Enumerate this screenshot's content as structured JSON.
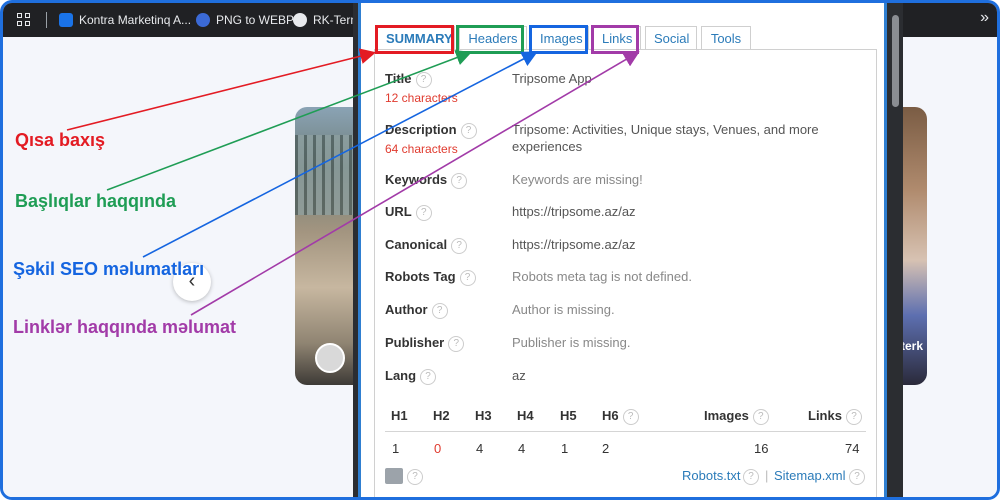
{
  "bookmarks": [
    {
      "label": "Kontra Marketinq A...",
      "color": "#1a73e8"
    },
    {
      "label": "PNG to WEBP",
      "color": "#3b6ad6"
    },
    {
      "label": "RK-Termi",
      "color": "#5f6368"
    }
  ],
  "bookmarks_more": "»",
  "background": {
    "right_card_text": "terk",
    "chevron": "‹"
  },
  "tabs": [
    "SUMMARY",
    "Headers",
    "Images",
    "Links",
    "Social",
    "Tools"
  ],
  "summary": {
    "title": {
      "label": "Title",
      "value": "Tripsome App",
      "chars": "12 characters"
    },
    "description": {
      "label": "Description",
      "value": "Tripsome: Activities, Unique stays, Venues, and more experiences",
      "chars": "64 characters"
    },
    "keywords": {
      "label": "Keywords",
      "value": "Keywords are missing!"
    },
    "url": {
      "label": "URL",
      "value": "https://tripsome.az/az"
    },
    "canonical": {
      "label": "Canonical",
      "value": "https://tripsome.az/az"
    },
    "robots": {
      "label": "Robots Tag",
      "value": "Robots meta tag is not defined."
    },
    "author": {
      "label": "Author",
      "value": "Author is missing."
    },
    "publisher": {
      "label": "Publisher",
      "value": "Publisher is missing."
    },
    "lang": {
      "label": "Lang",
      "value": "az"
    }
  },
  "stats": {
    "headers": [
      "H1",
      "H2",
      "H3",
      "H4",
      "H5",
      "H6",
      "Images",
      "Links"
    ],
    "values": [
      "1",
      "0",
      "4",
      "4",
      "1",
      "2",
      "16",
      "74"
    ]
  },
  "footer": {
    "robots_link": "Robots.txt",
    "divider": "|",
    "sitemap_link": "Sitemap.xml"
  },
  "annotations": [
    {
      "text": "Qısa baxış",
      "color": "#e31b23"
    },
    {
      "text": "Başlıqlar haqqında",
      "color": "#1f9d55"
    },
    {
      "text": "Şəkil SEO məlumatları",
      "color": "#1565e0"
    },
    {
      "text": "Linklər haqqında məlumat",
      "color": "#a23ba8"
    }
  ],
  "help_glyph": "?"
}
